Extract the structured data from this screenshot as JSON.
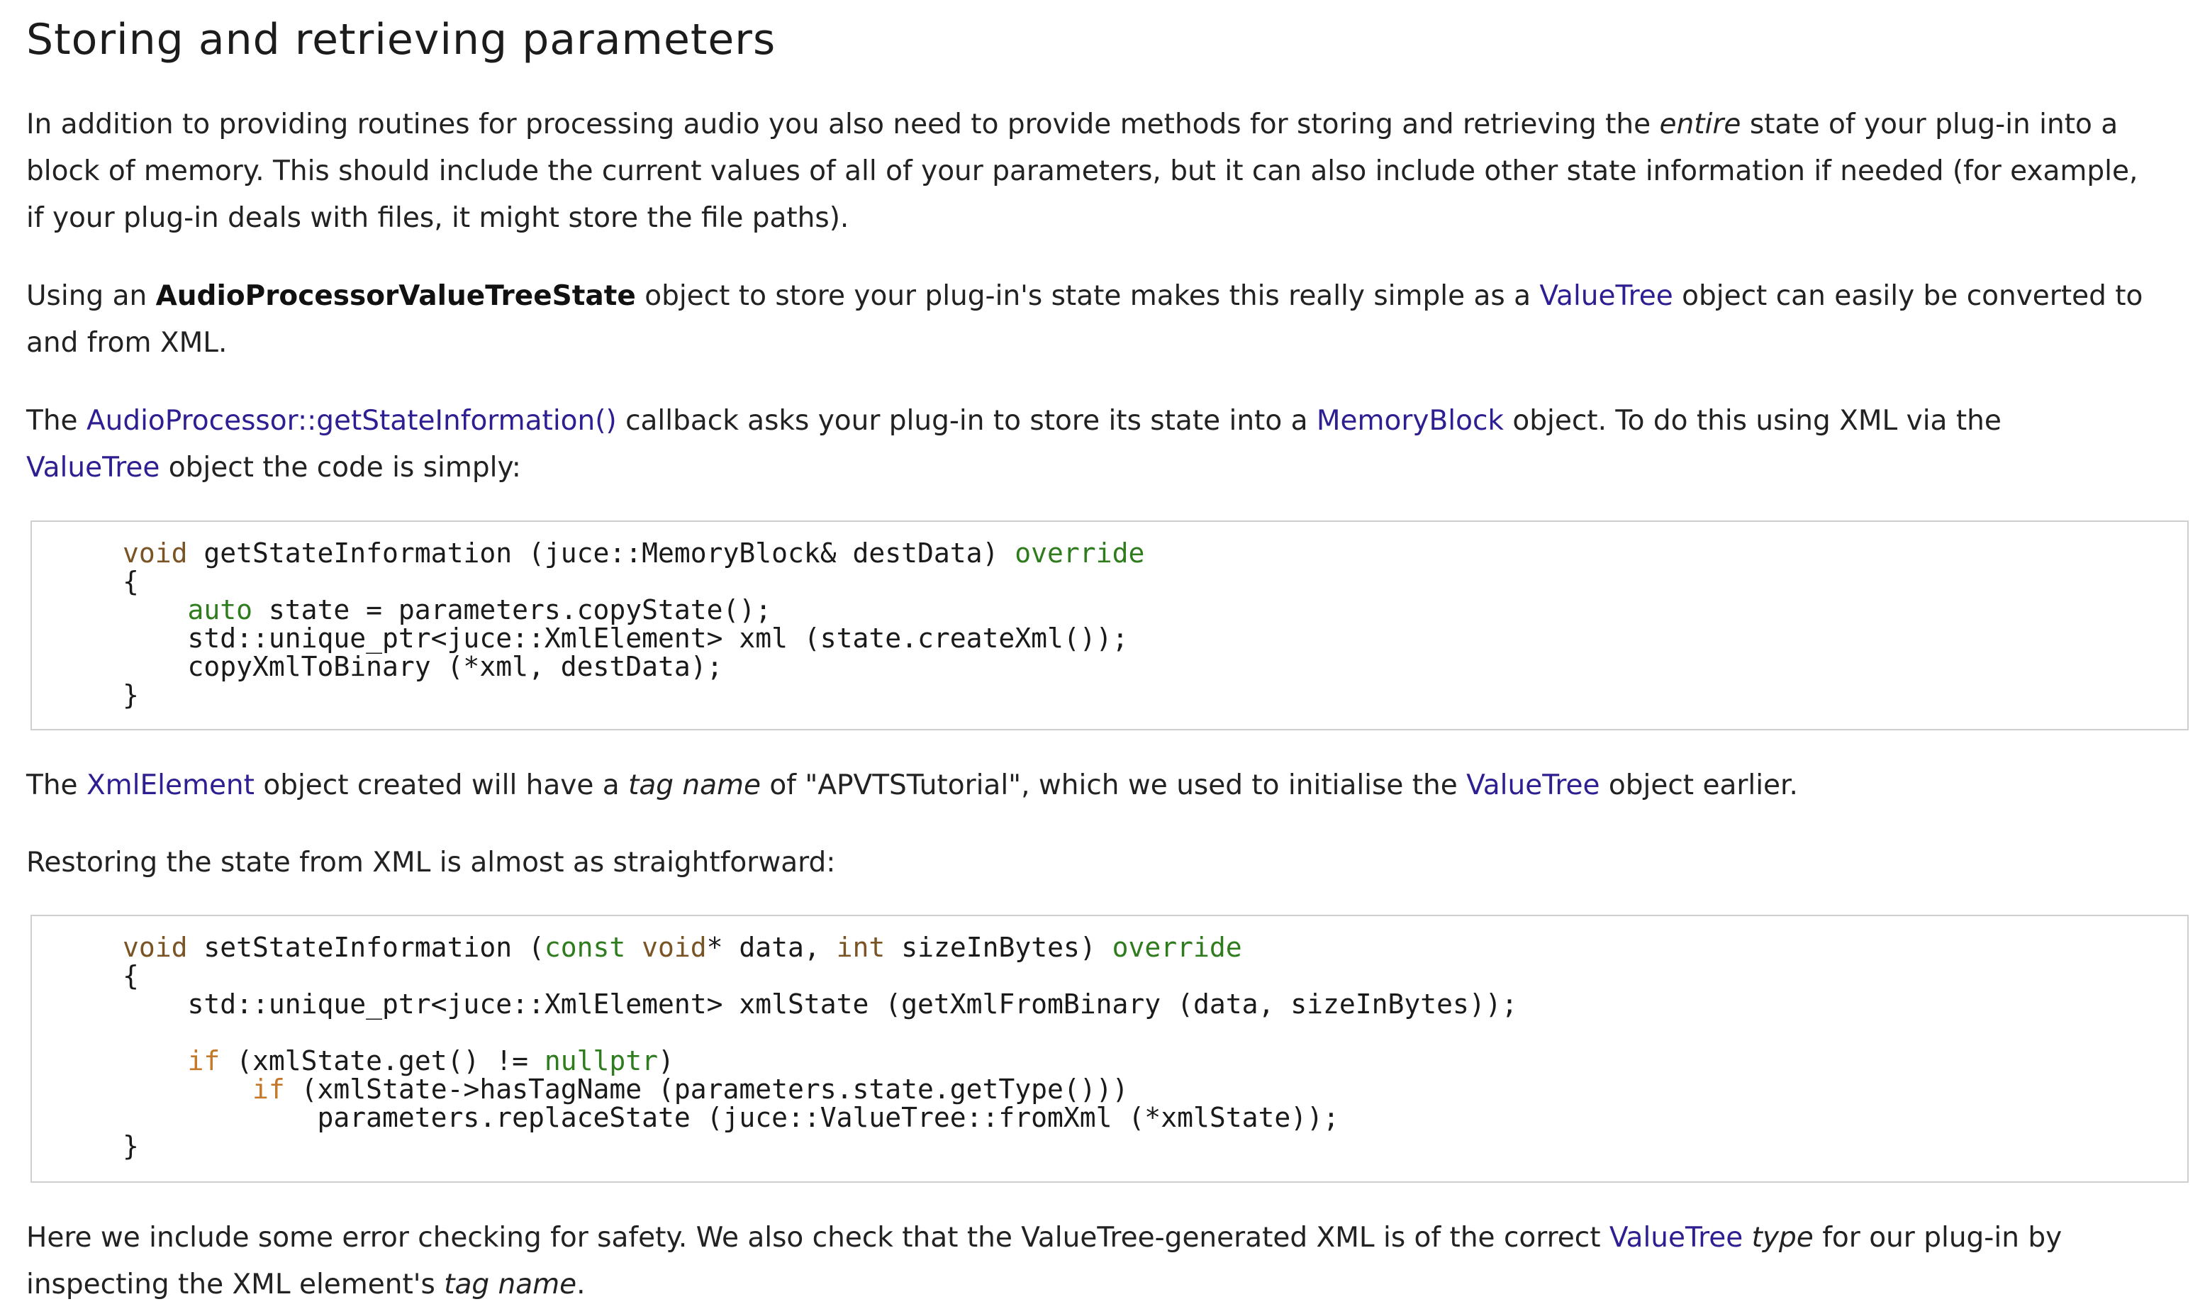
{
  "title": "Storing and retrieving parameters",
  "p1": {
    "l1a": "In addition to providing routines for processing audio you also need to provide methods for storing and retrieving the ",
    "l1em": "entire",
    "l1b": " state of your plug-in into a",
    "l2": "block of memory. This should include the current values of all of your parameters, but it can also include other state information if needed (for example,",
    "l3": "if your plug-in deals with files, it might store the file paths)."
  },
  "p2": {
    "a": "Using an ",
    "b": "AudioProcessorValueTreeState",
    "c": " object to store your plug-in's state makes this really simple as a ",
    "d": "ValueTree",
    "e": " object can easily be converted to",
    "l2": "and from XML."
  },
  "p3": {
    "a": "The ",
    "b": "AudioProcessor::getStateInformation()",
    "c": " callback asks your plug-in to store its state into a ",
    "d": "MemoryBlock",
    "e": " object. To do this using XML via the",
    "f": "ValueTree",
    "g": " object the code is simply:"
  },
  "code1": {
    "l1a": "void",
    "l1b": " getStateInformation (juce::MemoryBlock& destData) ",
    "l1c": "override",
    "l2": "{",
    "l3a": "    ",
    "l3b": "auto",
    "l3c": " state = parameters.copyState();",
    "l4": "    std::unique_ptr<juce::XmlElement> xml (state.createXml());",
    "l5": "    copyXmlToBinary (*xml, destData);",
    "l6": "}"
  },
  "p4": {
    "a": "The ",
    "b": "XmlElement",
    "c": " object created will have a ",
    "d": "tag name",
    "e": " of \"APVTSTutorial\", which we used to initialise the ",
    "f": "ValueTree",
    "g": " object earlier."
  },
  "p5": "Restoring the state from XML is almost as straightforward:",
  "code2": {
    "l1a": "void",
    "l1b": " setStateInformation (",
    "l1c": "const",
    "l1d": " ",
    "l1e": "void",
    "l1f": "* data, ",
    "l1g": "int",
    "l1h": " sizeInBytes) ",
    "l1i": "override",
    "l2": "{",
    "l3": "    std::unique_ptr<juce::XmlElement> xmlState (getXmlFromBinary (data, sizeInBytes));",
    "l5a": "    ",
    "l5b": "if",
    "l5c": " (xmlState.get() != ",
    "l5d": "nullptr",
    "l5e": ")",
    "l6a": "        ",
    "l6b": "if",
    "l6c": " (xmlState->hasTagName (parameters.state.getType()))",
    "l7": "            parameters.replaceState (juce::ValueTree::fromXml (*xmlState));",
    "l8": "}"
  },
  "p6": {
    "a": "Here we include some error checking for safety. We also check that the ValueTree-generated XML is of the correct ",
    "b": "ValueTree",
    "c": " ",
    "d": "type",
    "e": " for our plug-in by",
    "f": "inspecting the XML element's ",
    "g": "tag name",
    "h": "."
  }
}
